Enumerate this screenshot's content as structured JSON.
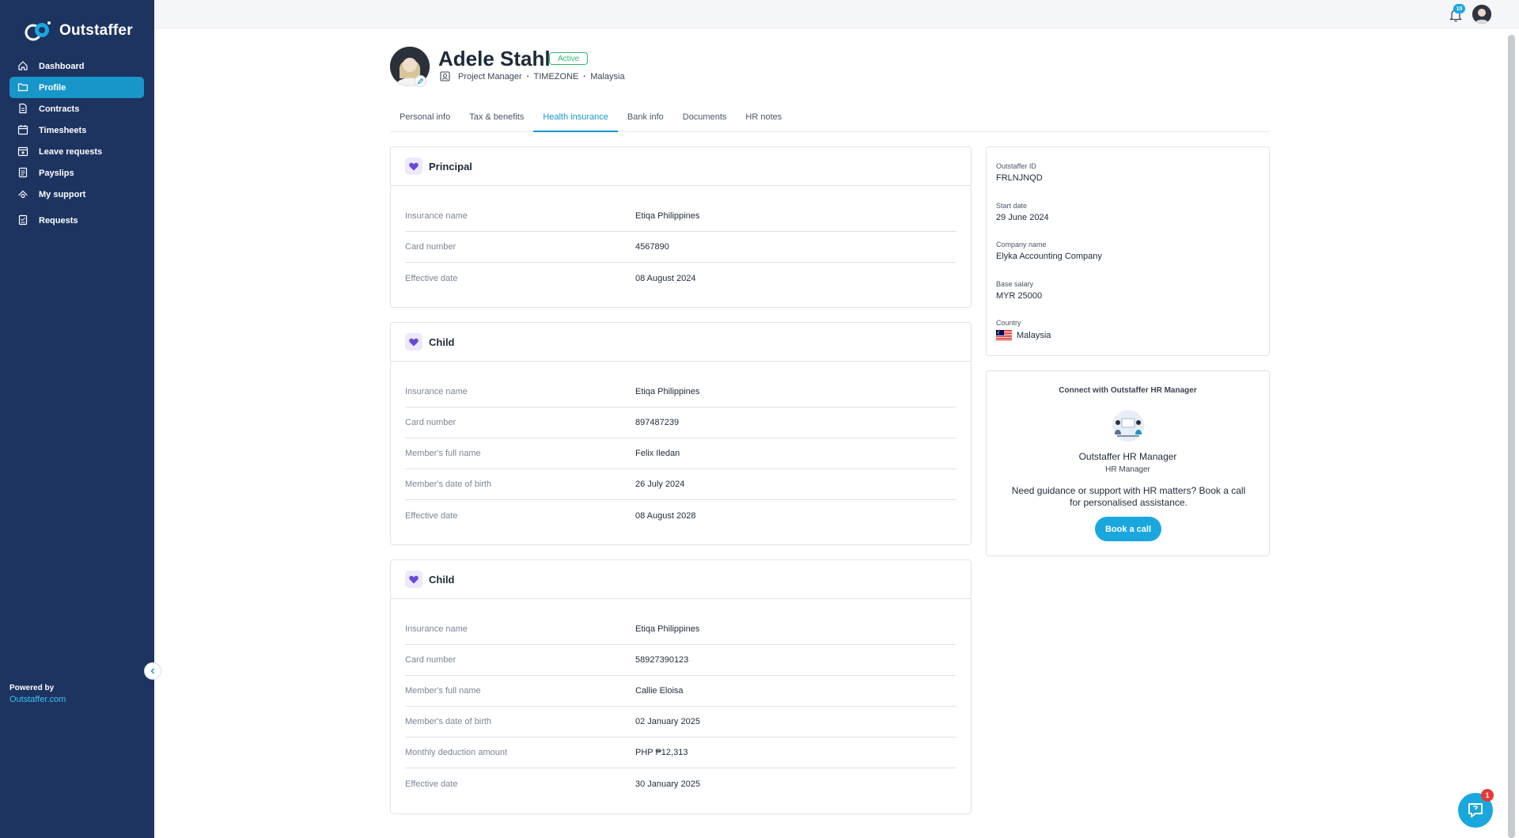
{
  "app": {
    "brand": "Outstaffer"
  },
  "sidebar": {
    "items": [
      {
        "label": "Dashboard",
        "icon": "home-icon",
        "active": false
      },
      {
        "label": "Profile",
        "icon": "folder-icon",
        "active": true
      },
      {
        "label": "Contracts",
        "icon": "document-icon",
        "active": false
      },
      {
        "label": "Timesheets",
        "icon": "calendar-icon",
        "active": false
      },
      {
        "label": "Leave requests",
        "icon": "calendar-plus-icon",
        "active": false
      },
      {
        "label": "Payslips",
        "icon": "payslip-icon",
        "active": false
      },
      {
        "label": "My support",
        "icon": "support-icon",
        "active": false
      },
      {
        "label": "Requests",
        "icon": "requests-icon",
        "active": false
      }
    ],
    "powered_by": "Powered by",
    "powered_link": "Outstaffer.com"
  },
  "topbar": {
    "notifications_count": "10"
  },
  "profile": {
    "name": "Adele Stahl",
    "status": "Active",
    "role": "Project Manager",
    "company": "TIMEZONE",
    "country": "Malaysia"
  },
  "tabs": [
    {
      "label": "Personal info",
      "active": false
    },
    {
      "label": "Tax & benefits",
      "active": false
    },
    {
      "label": "Health insurance",
      "active": true
    },
    {
      "label": "Bank info",
      "active": false
    },
    {
      "label": "Documents",
      "active": false
    },
    {
      "label": "HR notes",
      "active": false
    }
  ],
  "insurance_cards": [
    {
      "title": "Principal",
      "rows": [
        {
          "label": "Insurance name",
          "value": "Etiqa Philippines"
        },
        {
          "label": "Card number",
          "value": "4567890"
        },
        {
          "label": "Effective date",
          "value": "08 August 2024"
        }
      ]
    },
    {
      "title": "Child",
      "rows": [
        {
          "label": "Insurance name",
          "value": "Etiqa Philippines"
        },
        {
          "label": "Card number",
          "value": "897487239"
        },
        {
          "label": "Member's full name",
          "value": "Felix Iledan"
        },
        {
          "label": "Member's date of birth",
          "value": "26 July 2024"
        },
        {
          "label": "Effective date",
          "value": "08 August 2028"
        }
      ]
    },
    {
      "title": "Child",
      "rows": [
        {
          "label": "Insurance name",
          "value": "Etiqa Philippines"
        },
        {
          "label": "Card number",
          "value": "58927390123"
        },
        {
          "label": "Member's full name",
          "value": "Callie Eloisa"
        },
        {
          "label": "Member's date of birth",
          "value": "02 January 2025"
        },
        {
          "label": "Monthly deduction amount",
          "value": "PHP ₱12,313"
        },
        {
          "label": "Effective date",
          "value": "30 January 2025"
        }
      ]
    }
  ],
  "summary": {
    "outstaffer_id_label": "Outstaffer ID",
    "outstaffer_id": "FRLNJNQD",
    "start_date_label": "Start date",
    "start_date": "29 June 2024",
    "company_name_label": "Company name",
    "company_name": "Elyka Accounting Company",
    "base_salary_label": "Base salary",
    "base_salary": "MYR 25000",
    "country_label": "Country",
    "country": "Malaysia"
  },
  "hr_manager": {
    "heading": "Connect with Outstaffer HR Manager",
    "name": "Outstaffer HR Manager",
    "role": "HR Manager",
    "description": "Need guidance or support with HR matters? Book a call for personalised assistance.",
    "button": "Book a call"
  },
  "chat": {
    "badge": "1"
  },
  "colors": {
    "sidebar": "#1d3461",
    "accent": "#1797c9",
    "active_badge": "#33b86b"
  }
}
